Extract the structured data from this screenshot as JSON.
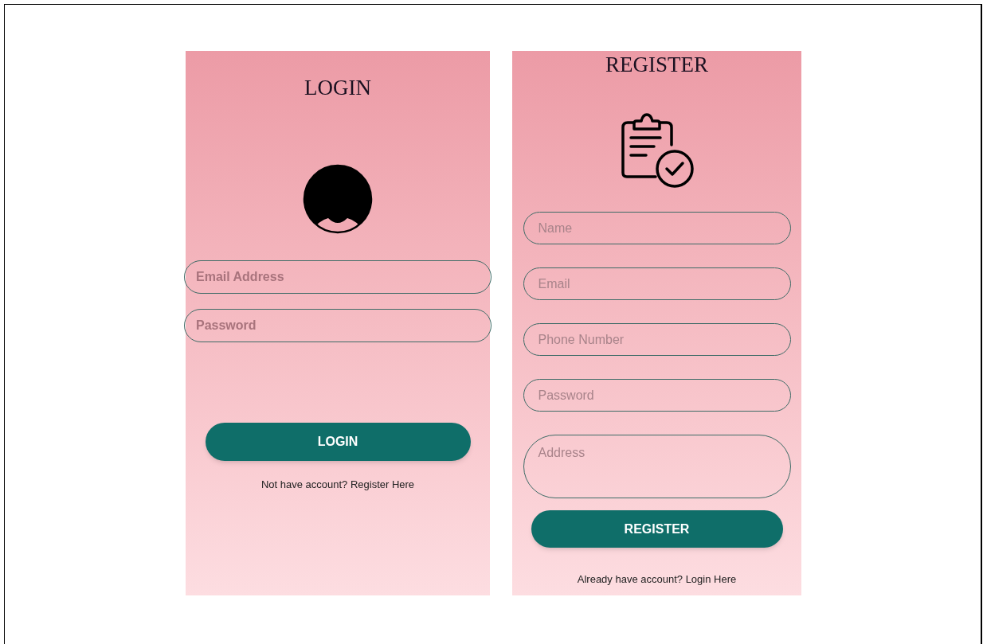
{
  "login": {
    "title": "LOGIN",
    "fields": [
      {
        "placeholder": "Email Address",
        "kind": "line"
      },
      {
        "placeholder": "Password",
        "kind": "line"
      }
    ],
    "button": "LOGIN",
    "link": "Not have account? Register Here"
  },
  "register": {
    "title": "REGISTER",
    "fields": [
      {
        "placeholder": "Name",
        "kind": "line"
      },
      {
        "placeholder": "Email",
        "kind": "line"
      },
      {
        "placeholder": "Phone Number",
        "kind": "line"
      },
      {
        "placeholder": "Password",
        "kind": "line"
      },
      {
        "placeholder": "Address",
        "kind": "multiline"
      }
    ],
    "button": "REGISTER",
    "link": "Already have account? Login Here"
  }
}
